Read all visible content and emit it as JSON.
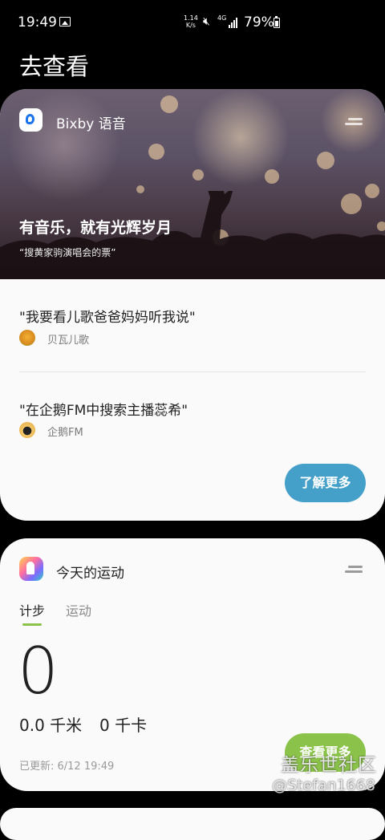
{
  "status_bar": {
    "time": "19:49",
    "net_speed_value": "1.14",
    "net_speed_unit": "K/s",
    "network_type": "4G",
    "battery": "79%"
  },
  "page_title": "去查看",
  "bixby_card": {
    "app_name": "Bixby 语音",
    "hero_title": "有音乐，就有光辉岁月",
    "hero_subtitle": "“搜黄家驹演唱会的票”",
    "commands": [
      {
        "text": "\"我要看儿歌爸爸妈妈听我说\"",
        "app": "贝瓦儿歌"
      },
      {
        "text": "\"在企鹅FM中搜索主播蕊希\"",
        "app": "企鹅FM"
      }
    ],
    "learn_more_label": "了解更多"
  },
  "health_card": {
    "title": "今天的运动",
    "tabs": [
      "计步",
      "运动"
    ],
    "active_tab": "计步",
    "steps": "0",
    "distance": "0.0 千米",
    "calories": "0 千卡",
    "updated": "已更新:  6/12 19:49",
    "view_more_label": "查看更多"
  },
  "watermark": {
    "line1": "盖乐世社区",
    "line2": "@Stefan1668"
  },
  "colors": {
    "learn_more_button": "#45a0c9",
    "view_more_button": "#8bc34a",
    "active_tab_indicator": "#8bc34a"
  }
}
